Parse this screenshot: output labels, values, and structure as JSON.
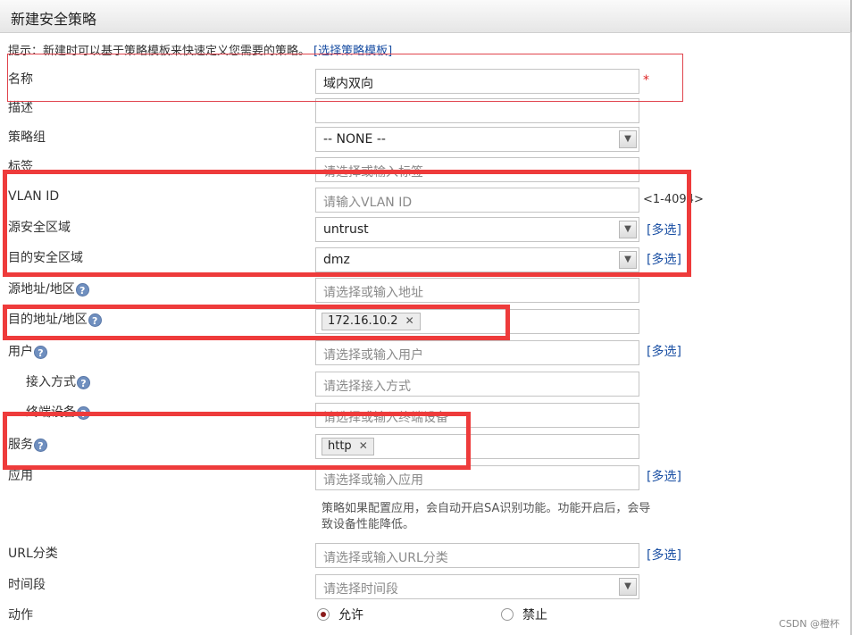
{
  "window": {
    "title": "新建安全策略"
  },
  "hint": {
    "text": "提示：新建时可以基于策略模板来快速定义您需要的策略。",
    "link": "[选择策略模板]"
  },
  "fields": {
    "name": {
      "label": "名称",
      "value": "域内双向",
      "required_mark": "*"
    },
    "description": {
      "label": "描述",
      "value": ""
    },
    "policy_group": {
      "label": "策略组",
      "value": "-- NONE --"
    },
    "tag": {
      "label": "标签",
      "placeholder": "请选择或输入标签"
    },
    "vlan_id": {
      "label": "VLAN ID",
      "placeholder": "请输入VLAN ID",
      "range": "<1-4094>"
    },
    "src_zone": {
      "label": "源安全区域",
      "value": "untrust",
      "link": "[多选]"
    },
    "dst_zone": {
      "label": "目的安全区域",
      "value": "dmz",
      "link": "[多选]"
    },
    "src_addr": {
      "label": "源地址/地区",
      "placeholder": "请选择或输入地址"
    },
    "dst_addr": {
      "label": "目的地址/地区",
      "tag": "172.16.10.2"
    },
    "user": {
      "label": "用户",
      "placeholder": "请选择或输入用户",
      "link": "[多选]"
    },
    "access_mode": {
      "label": "接入方式",
      "placeholder": "请选择接入方式"
    },
    "terminal_device": {
      "label": "终端设备",
      "placeholder": "请选择或输入终端设备"
    },
    "service": {
      "label": "服务",
      "tag": "http"
    },
    "application": {
      "label": "应用",
      "placeholder": "请选择或输入应用",
      "link": "[多选]",
      "note": "策略如果配置应用，会自动开启SA识别功能。功能开启后，会导致设备性能降低。"
    },
    "url_category": {
      "label": "URL分类",
      "placeholder": "请选择或输入URL分类",
      "link": "[多选]"
    },
    "time_range": {
      "label": "时间段",
      "placeholder": "请选择时间段"
    },
    "action": {
      "label": "动作",
      "options": [
        "允许",
        "禁止"
      ],
      "selected": "允许"
    }
  },
  "help_glyph": "?",
  "tag_remove_glyph": "✕",
  "select_arrow_glyph": "▼",
  "watermark": "CSDN @橙杯",
  "colors": {
    "highlight_red": "#ee3b3b",
    "link_blue": "#1a4fa3",
    "radio_selected": "#8b1b1b"
  }
}
